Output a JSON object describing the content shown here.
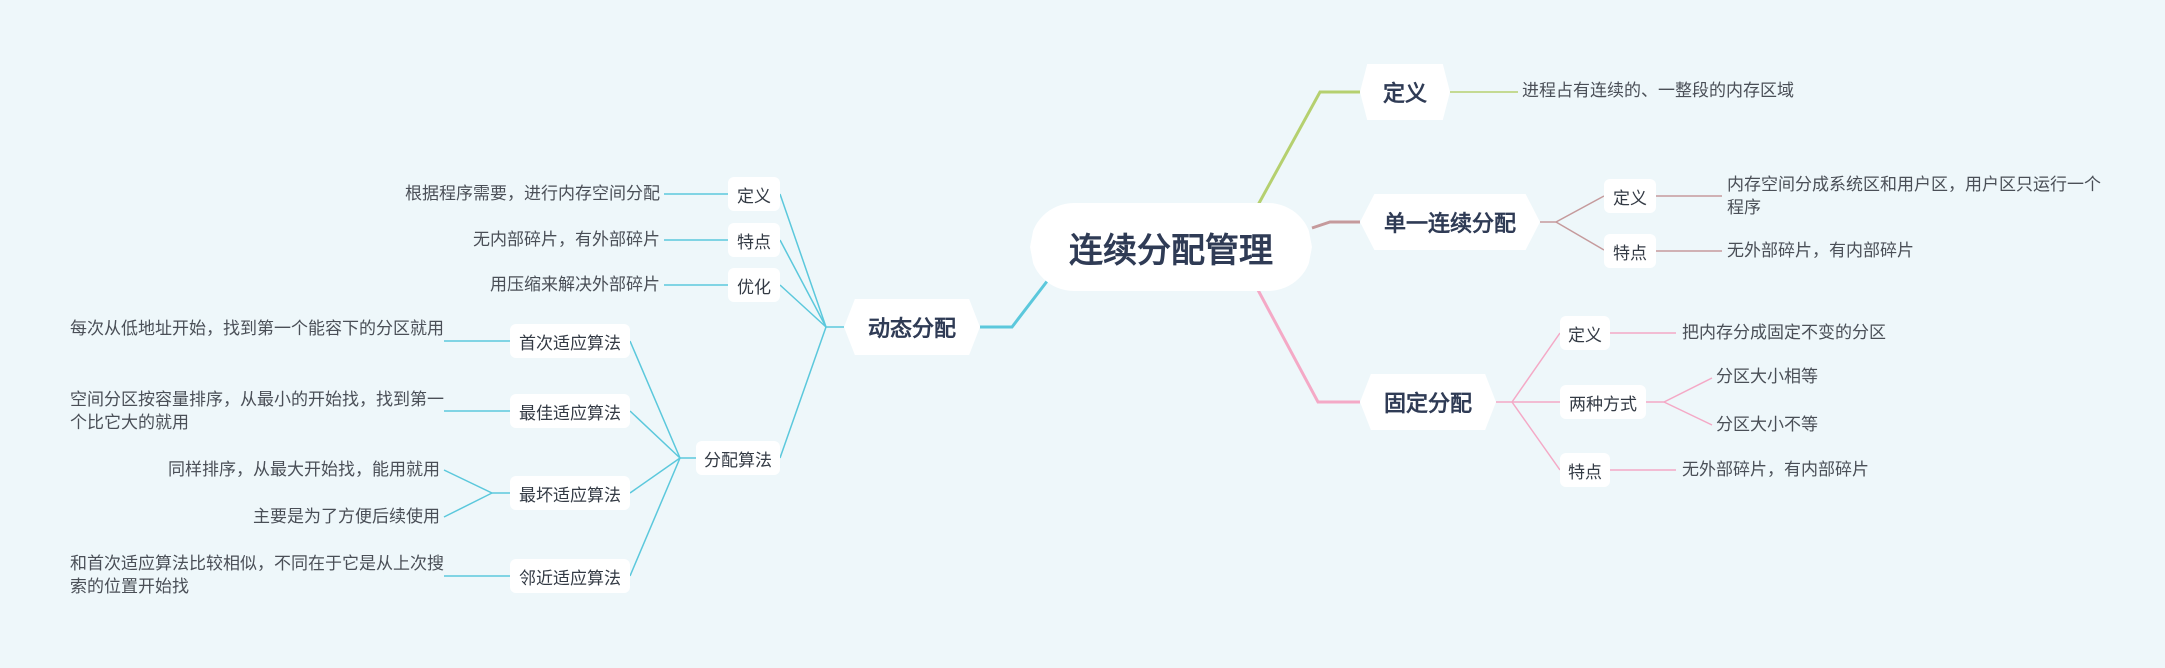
{
  "root": "连续分配管理",
  "right": {
    "definition": {
      "label": "定义",
      "text": "进程占有连续的、一整段的内存区域"
    },
    "single": {
      "label": "单一连续分配",
      "def_label": "定义",
      "def_text": "内存空间分成系统区和用户区，用户区只运行一个程序",
      "feat_label": "特点",
      "feat_text": "无外部碎片，有内部碎片"
    },
    "fixed": {
      "label": "固定分配",
      "def_label": "定义",
      "def_text": "把内存分成固定不变的分区",
      "ways_label": "两种方式",
      "way1": "分区大小相等",
      "way2": "分区大小不等",
      "feat_label": "特点",
      "feat_text": "无外部碎片，有内部碎片"
    }
  },
  "left": {
    "dynamic": {
      "label": "动态分配",
      "def_label": "定义",
      "def_text": "根据程序需要，进行内存空间分配",
      "feat_label": "特点",
      "feat_text": "无内部碎片，有外部碎片",
      "opt_label": "优化",
      "opt_text": "用压缩来解决外部碎片",
      "algo_label": "分配算法",
      "algos": {
        "first": {
          "label": "首次适应算法",
          "text": "每次从低地址开始，找到第一个能容下的分区就用"
        },
        "best": {
          "label": "最佳适应算法",
          "text": "空间分区按容量排序，从最小的开始找，找到第一个比它大的就用"
        },
        "worst": {
          "label": "最坏适应算法",
          "text1": "同样排序，从最大开始找，能用就用",
          "text2": "主要是为了方便后续使用"
        },
        "next": {
          "label": "邻近适应算法",
          "text": "和首次适应算法比较相似，不同在于它是从上次搜索的位置开始找"
        }
      }
    }
  },
  "colors": {
    "background": "#eef7fa",
    "definition_branch": "#b5d06f",
    "single_branch": "#c59a9c",
    "fixed_branch": "#f4a9c6",
    "dynamic_branch": "#5bc8dc",
    "node_text": "#2f3b55"
  }
}
